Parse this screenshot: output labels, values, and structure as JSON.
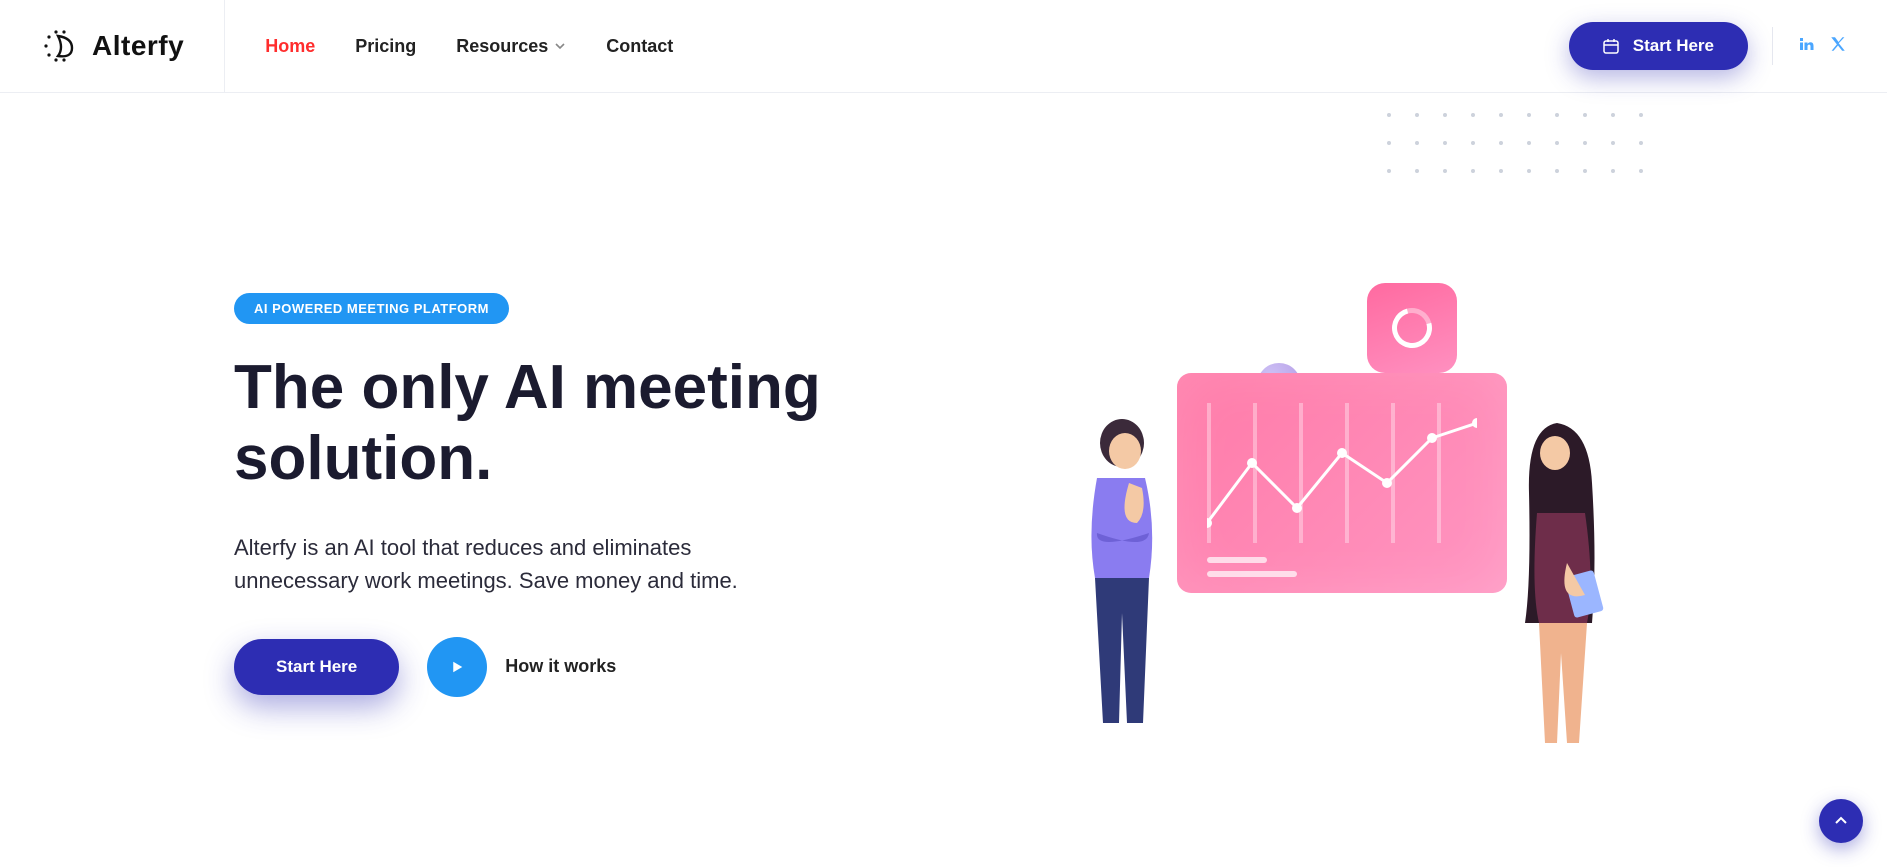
{
  "brand": {
    "name": "Alterfy"
  },
  "nav": {
    "items": [
      {
        "label": "Home",
        "active": true
      },
      {
        "label": "Pricing",
        "active": false
      },
      {
        "label": "Resources",
        "active": false,
        "has_dropdown": true
      },
      {
        "label": "Contact",
        "active": false
      }
    ]
  },
  "header_cta": {
    "label": "Start Here"
  },
  "social": {
    "linkedin": "linkedin",
    "x": "x-twitter"
  },
  "hero": {
    "pill": "AI POWERED MEETING PLATFORM",
    "headline": "The only AI meeting solution.",
    "sub": "Alterfy is an AI tool that reduces and eliminates unnecessary work meetings. Save money and time.",
    "cta_primary": "Start Here",
    "cta_secondary": "How it works"
  },
  "colors": {
    "brand_primary": "#2d2db3",
    "accent_blue": "#2196f3",
    "nav_active": "#ff2d2d",
    "pink_start": "#ff7aa8",
    "pink_end": "#ff96c2"
  }
}
